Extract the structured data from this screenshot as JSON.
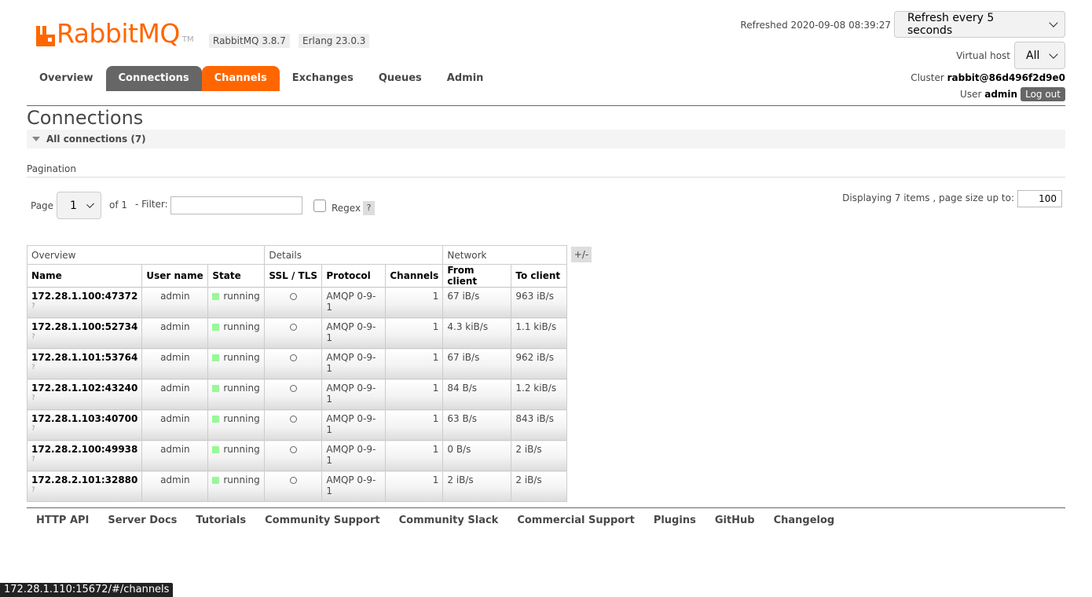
{
  "header": {
    "brand": "RabbitMQ",
    "trademark": "TM",
    "version": "RabbitMQ 3.8.7",
    "erlang": "Erlang 23.0.3",
    "refreshed": "Refreshed 2020-09-08 08:39:27",
    "refresh_select": "Refresh every 5 seconds",
    "vhost_label": "Virtual host",
    "vhost_value": "All",
    "cluster_label": "Cluster",
    "cluster_name": "rabbit@86d496f2d9e0",
    "user_label": "User",
    "user_name": "admin",
    "logout": "Log out",
    "brand_color": "#ff6600"
  },
  "nav": {
    "tabs": [
      "Overview",
      "Connections",
      "Channels",
      "Exchanges",
      "Queues",
      "Admin"
    ],
    "selected": "Connections",
    "hovered": "Channels"
  },
  "main": {
    "title": "Connections",
    "section": "All connections (7)",
    "pagination_label": "Pagination",
    "page_label": "Page",
    "page_value": "1",
    "of_label": "of 1",
    "filter_label": "- Filter:",
    "filter_value": "",
    "regex_label": "Regex",
    "help": "?",
    "displaying": "Displaying 7 items , page size up to:",
    "page_size": "100",
    "toggle_columns": "+/-"
  },
  "table": {
    "groups": [
      "Overview",
      "Details",
      "Network"
    ],
    "columns": [
      "Name",
      "User name",
      "State",
      "SSL / TLS",
      "Protocol",
      "Channels",
      "From client",
      "To client"
    ],
    "rows": [
      {
        "name": "172.28.1.100:47372",
        "q": "?",
        "user": "admin",
        "state": "running",
        "protocol": "AMQP 0-9-1",
        "channels": "1",
        "from": "67 iB/s",
        "to": "963 iB/s"
      },
      {
        "name": "172.28.1.100:52734",
        "q": "?",
        "user": "admin",
        "state": "running",
        "protocol": "AMQP 0-9-1",
        "channels": "1",
        "from": "4.3 kiB/s",
        "to": "1.1 kiB/s"
      },
      {
        "name": "172.28.1.101:53764",
        "q": "?",
        "user": "admin",
        "state": "running",
        "protocol": "AMQP 0-9-1",
        "channels": "1",
        "from": "67 iB/s",
        "to": "962 iB/s"
      },
      {
        "name": "172.28.1.102:43240",
        "q": "?",
        "user": "admin",
        "state": "running",
        "protocol": "AMQP 0-9-1",
        "channels": "1",
        "from": "84 B/s",
        "to": "1.2 kiB/s"
      },
      {
        "name": "172.28.1.103:40700",
        "q": "?",
        "user": "admin",
        "state": "running",
        "protocol": "AMQP 0-9-1",
        "channels": "1",
        "from": "63 B/s",
        "to": "843 iB/s"
      },
      {
        "name": "172.28.2.100:49938",
        "q": "?",
        "user": "admin",
        "state": "running",
        "protocol": "AMQP 0-9-1",
        "channels": "1",
        "from": "0 B/s",
        "to": "2 iB/s"
      },
      {
        "name": "172.28.2.101:32880",
        "q": "?",
        "user": "admin",
        "state": "running",
        "protocol": "AMQP 0-9-1",
        "channels": "1",
        "from": "2 iB/s",
        "to": "2 iB/s"
      }
    ],
    "state_color": "#98f898"
  },
  "footer": {
    "links": [
      "HTTP API",
      "Server Docs",
      "Tutorials",
      "Community Support",
      "Community Slack",
      "Commercial Support",
      "Plugins",
      "GitHub",
      "Changelog"
    ]
  },
  "statusbar": "172.28.1.110:15672/#/channels"
}
